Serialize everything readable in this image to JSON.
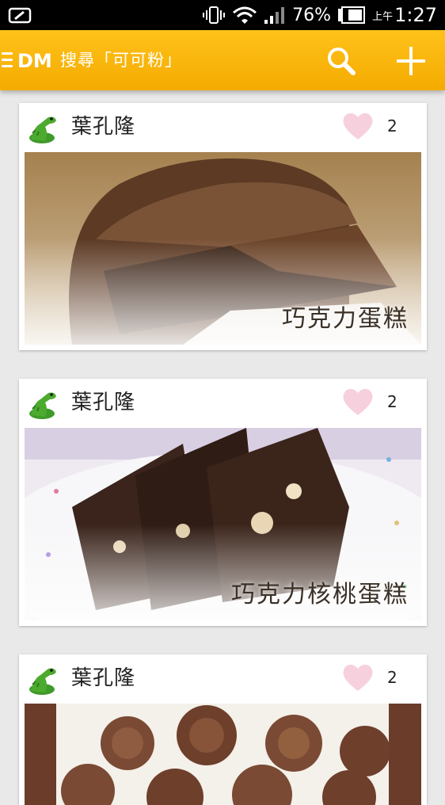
{
  "status_bar": {
    "battery_percent": "76%",
    "ampm": "上午",
    "time": "1:27"
  },
  "app_bar": {
    "logo_text": "DM",
    "title": "搜尋「可可粉」",
    "icons": [
      "menu-icon",
      "search-icon",
      "add-icon"
    ]
  },
  "posts": [
    {
      "author": "葉孔隆",
      "likes": "2",
      "caption": "巧克力蛋糕",
      "avatar_icon": "dinosaur-avatar"
    },
    {
      "author": "葉孔隆",
      "likes": "2",
      "caption": "巧克力核桃蛋糕",
      "avatar_icon": "dinosaur-avatar"
    },
    {
      "author": "葉孔隆",
      "likes": "2",
      "caption": "",
      "avatar_icon": "dinosaur-avatar"
    }
  ],
  "colors": {
    "app_bar": "#f6b200",
    "heart": "#f7d0dd",
    "background": "#e9e9e9"
  }
}
